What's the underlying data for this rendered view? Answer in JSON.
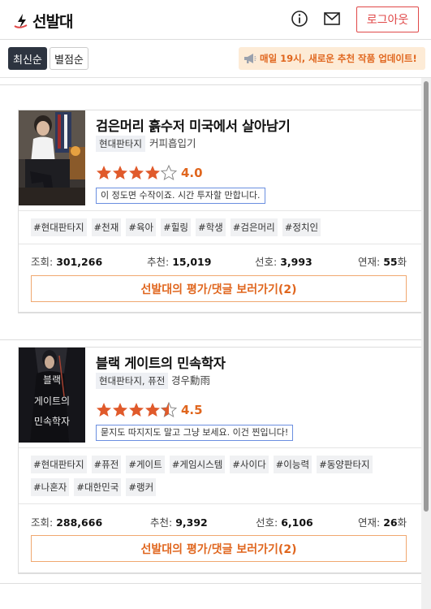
{
  "header": {
    "logo_text": "선발대",
    "logout_label": "로그아웃"
  },
  "sort": {
    "latest": "최신순",
    "rating": "별점순"
  },
  "notice": "매일 19시, 새로운 추천 작품 업데이트!",
  "cards": [
    {
      "title": "검은머리 흙수저 미국에서 살아남기",
      "genre": "현대판타지",
      "author": "커피흡입기",
      "rating": "4.0",
      "stars": 4,
      "comment": "이 정도면 수작이죠. 시간 투자할 만합니다.",
      "tags": [
        "#현대판타지",
        "#천재",
        "#육아",
        "#힐링",
        "#학생",
        "#검은머리",
        "#정치인"
      ],
      "stats": {
        "views_label": "조회:",
        "views": "301,266",
        "recommend_label": "추천:",
        "recommend": "15,019",
        "pref_label": "선호:",
        "pref": "3,993",
        "serial_label": "연재:",
        "serial": "55",
        "serial_unit": "화"
      },
      "button": "선발대의 평가/댓글 보러가기(2)"
    },
    {
      "title": "블랙 게이트의 민속학자",
      "genre": "현대판타지, 퓨전",
      "author": "경우勳雨",
      "rating": "4.5",
      "stars": 4.5,
      "comment": "묻지도 따지지도 말고 그냥 보세요. 이건 찐입니다!",
      "cover_text": [
        "블랙",
        "게이트의",
        "민속학자"
      ],
      "tags": [
        "#현대판타지",
        "#퓨전",
        "#게이트",
        "#게임시스템",
        "#사이다",
        "#이능력",
        "#동양판타지",
        "#나혼자",
        "#대한민국",
        "#랭커"
      ],
      "stats": {
        "views_label": "조회:",
        "views": "288,666",
        "recommend_label": "추천:",
        "recommend": "9,392",
        "pref_label": "선호:",
        "pref": "6,106",
        "serial_label": "연재:",
        "serial": "26",
        "serial_unit": "화"
      },
      "button": "선발대의 평가/댓글 보러가기(2)"
    }
  ],
  "colors": {
    "accent": "#e0661e",
    "logout": "#e04848",
    "star": "#e05a2b",
    "sort_active": "#2d3440",
    "notice_bg": "#fdebd6"
  }
}
